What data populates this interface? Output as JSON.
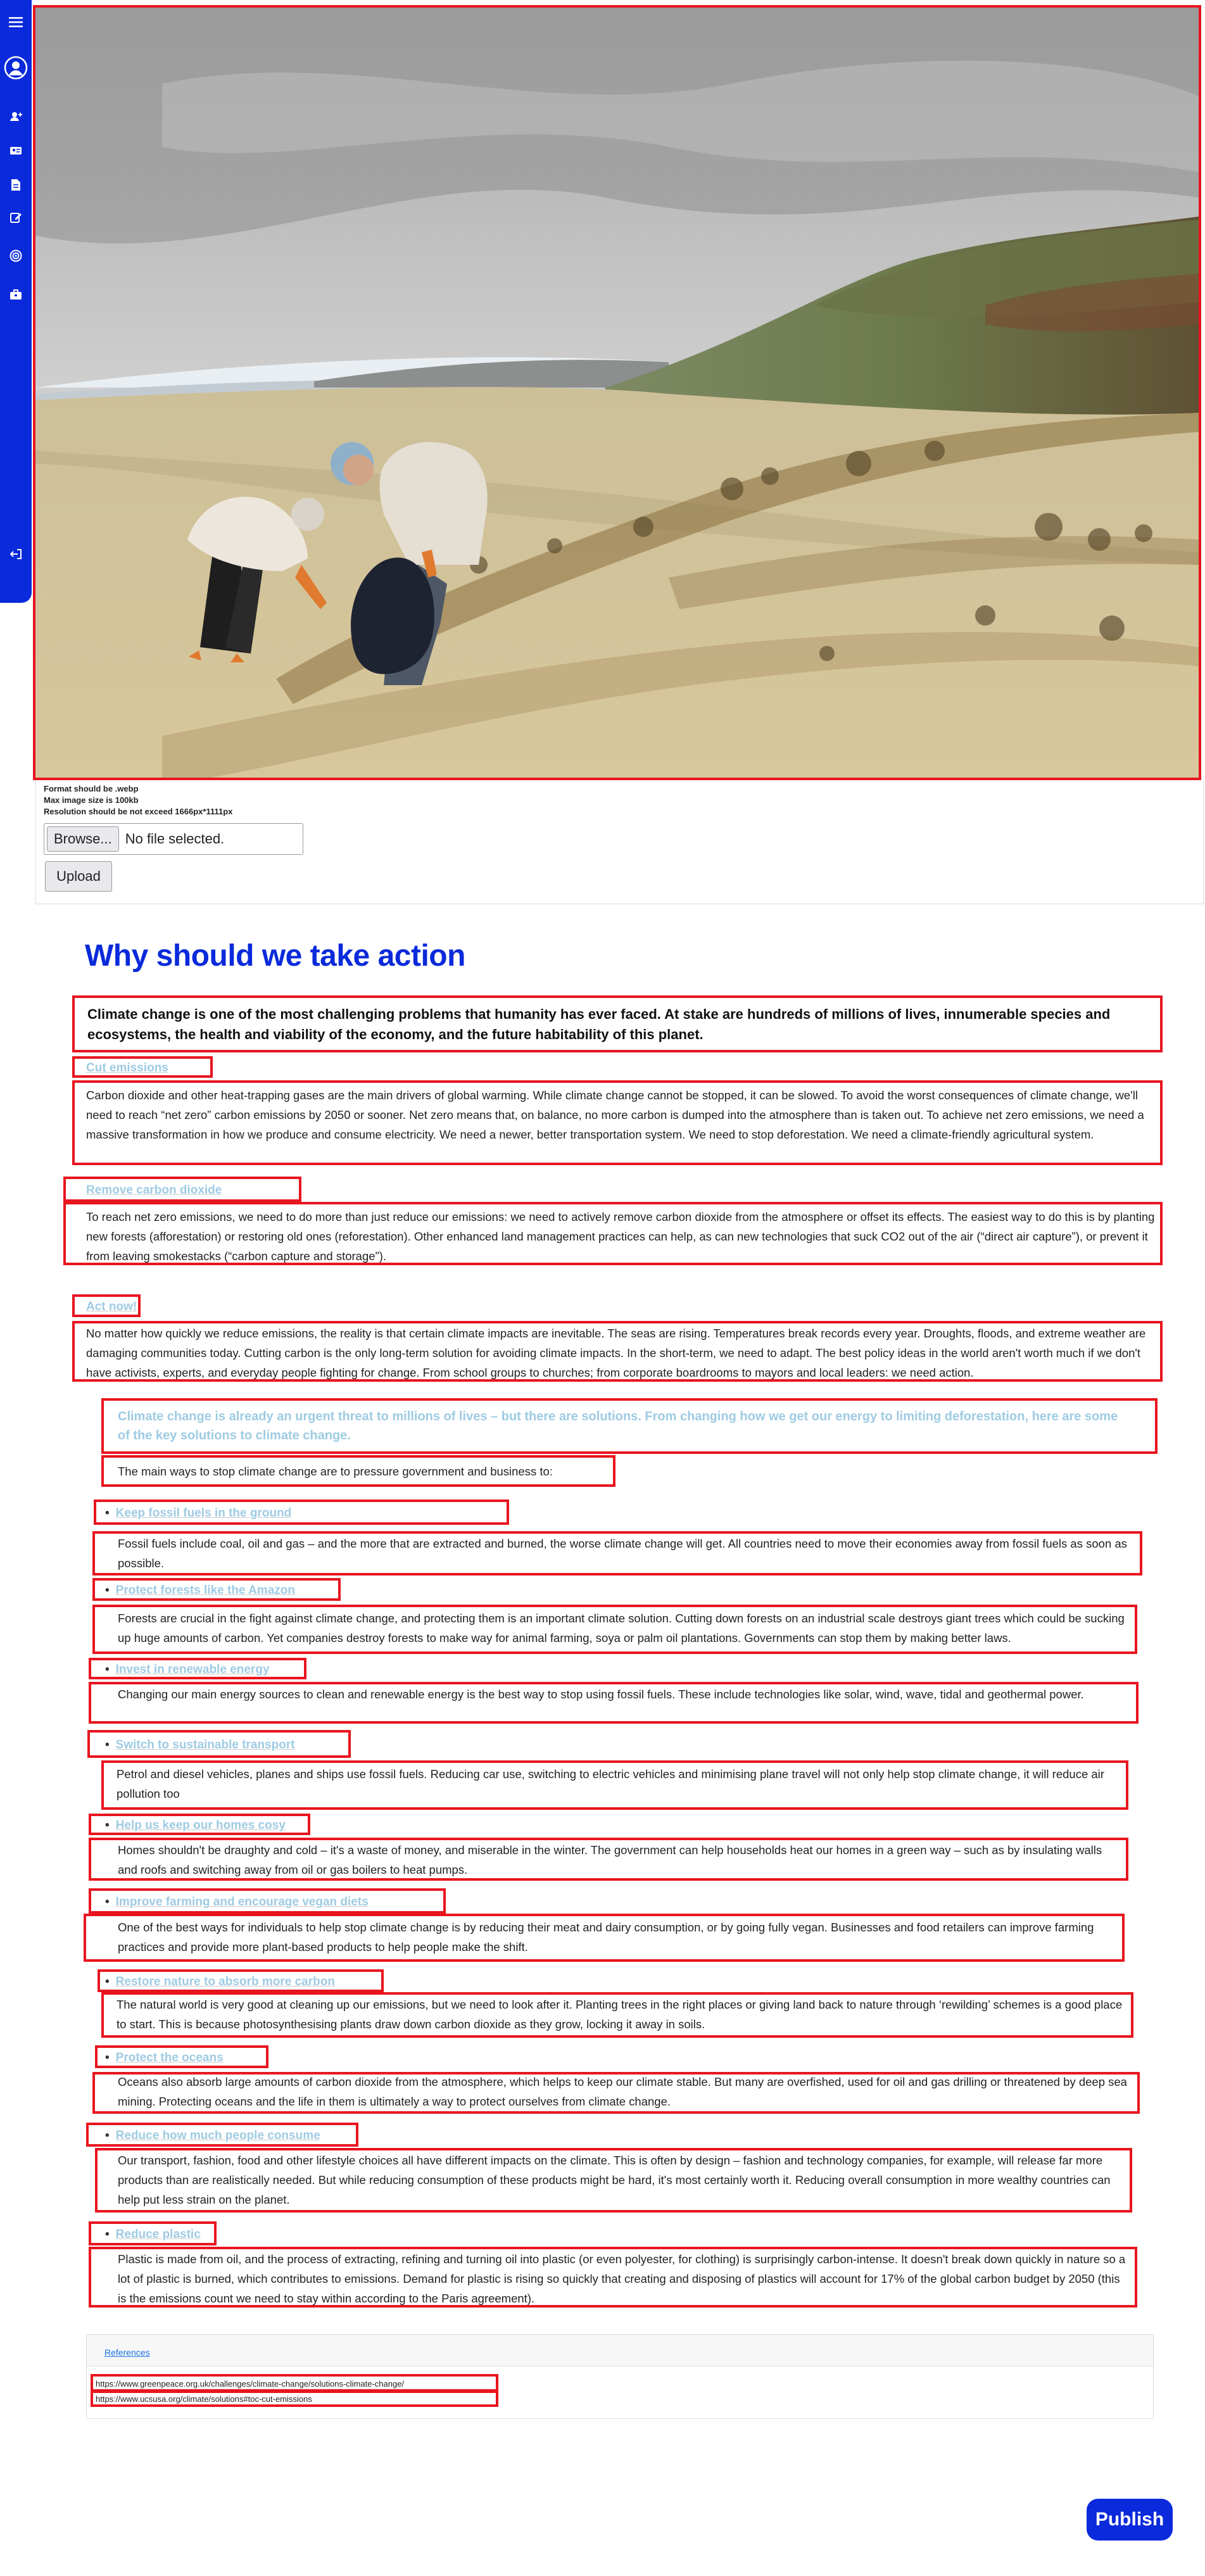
{
  "sidebar": {
    "items": [
      {
        "icon": "menu-icon"
      },
      {
        "icon": "user-avatar-icon"
      },
      {
        "icon": "add-user-icon"
      },
      {
        "icon": "id-card-icon"
      },
      {
        "icon": "document-icon"
      },
      {
        "icon": "edit-icon"
      },
      {
        "icon": "target-icon"
      },
      {
        "icon": "briefcase-icon"
      },
      {
        "icon": "logout-icon"
      }
    ]
  },
  "upload": {
    "note_format": "Format should be .webp",
    "note_size": "Max image size is 100kb",
    "note_resolution": "Resolution should be not exceed 1666px*1111px",
    "browse_label": "Browse...",
    "no_file_label": "No file selected.",
    "upload_label": "Upload"
  },
  "article": {
    "title": "Why should we take action",
    "lead": "Climate change is one of the most challenging problems that humanity has ever faced. At stake are hundreds of millions of lives, innumerable species and ecosystems, the health and viability of the economy, and the future habitability of this planet.",
    "sections": [
      {
        "heading": "Cut emissions",
        "body": "Carbon dioxide and other heat-trapping gases are the main drivers of global warming. While climate change cannot be stopped, it can be slowed. To avoid the worst consequences of climate change, we'll need to reach “net zero” carbon emissions by 2050 or sooner. Net zero means that, on balance, no more carbon is dumped into the atmosphere than is taken out. To achieve net zero emissions, we need a massive transformation in how we produce and consume electricity. We need a newer, better transportation system. We need to stop deforestation. We need a climate-friendly agricultural system."
      },
      {
        "heading": "Remove carbon dioxide",
        "body": "To reach net zero emissions, we need to do more than just reduce our emissions: we need to actively remove carbon dioxide from the atmosphere or offset its effects. The easiest way to do this is by planting new forests (afforestation) or restoring old ones (reforestation). Other enhanced land management practices can help, as can new technologies that suck CO2 out of the air (“direct air capture”), or prevent it from leaving smokestacks (“carbon capture and storage”)."
      },
      {
        "heading": "Act now!",
        "body": "No matter how quickly we reduce emissions, the reality is that certain climate impacts are inevitable. The seas are rising. Temperatures break records every year. Droughts, floods, and extreme weather are damaging communities today. Cutting carbon is the only long-term solution for avoiding climate impacts. In the short-term, we need to adapt. The best policy ideas in the world aren't worth much if we don't have activists, experts, and everyday people fighting for change. From school groups to churches; from corporate boardrooms to mayors and local leaders: we need action."
      }
    ],
    "callout": "Climate change is already an urgent threat to millions of lives – but there are solutions. From changing how we get our energy to limiting deforestation, here are some of the key solutions to climate change.",
    "intro": "The main ways to stop climate change are to pressure government and business to:",
    "solutions": [
      {
        "heading": "Keep fossil fuels in the ground",
        "body": "Fossil fuels include coal, oil and gas – and the more that are extracted and burned, the worse climate change will get. All countries need to move their economies away from fossil fuels as soon as possible."
      },
      {
        "heading": "Protect forests like the Amazon",
        "body": "Forests are crucial in the fight against climate change, and protecting them is an important climate solution. Cutting down forests on an industrial scale destroys giant trees which could be sucking up huge amounts of carbon. Yet companies destroy forests to make way for animal farming, soya or palm oil plantations. Governments can stop them by making better laws."
      },
      {
        "heading": "Invest in renewable energy",
        "body": "Changing our main energy sources to clean and renewable energy is the best way to stop using fossil fuels. These include technologies like solar, wind, wave, tidal and geothermal power."
      },
      {
        "heading": "Switch to sustainable transport",
        "body": "Petrol and diesel vehicles, planes and ships use fossil fuels. Reducing car use, switching to electric vehicles and minimising plane travel will not only help stop climate change, it will reduce air pollution too"
      },
      {
        "heading": "Help us keep our homes cosy",
        "body": "Homes shouldn't be draughty and cold – it's a waste of money, and miserable in the winter. The government can help households heat our homes in a green way – such as by insulating walls and roofs and switching away from oil or gas boilers to heat pumps."
      },
      {
        "heading": "Improve farming and encourage vegan diets",
        "body": "One of the best ways for individuals to help stop climate change is by reducing their meat and dairy consumption, or by going fully vegan. Businesses and food retailers can improve farming practices and provide more plant-based products to help people make the shift."
      },
      {
        "heading": "Restore nature to absorb more carbon",
        "body": "The natural world is very good at cleaning up our emissions, but we need to look after it. Planting trees in the right places or giving land back to nature through ‘rewilding’ schemes is a good place to start. This is because photosynthesising plants draw down carbon dioxide as they grow, locking it away in soils."
      },
      {
        "heading": "Protect the oceans",
        "body": "Oceans also absorb large amounts of carbon dioxide from the atmosphere, which helps to keep our climate stable. But many are overfished, used for oil and gas drilling or threatened by deep sea mining. Protecting oceans and the life in them is ultimately a way to protect ourselves from climate change."
      },
      {
        "heading": "Reduce how much people consume",
        "body": "Our transport, fashion, food and other lifestyle choices all have different impacts on the climate. This is often by design – fashion and technology companies, for example, will release far more products than are realistically needed. But while reducing consumption of these products might be hard, it's most certainly worth it. Reducing overall consumption in more wealthy countries can help put less strain on the planet."
      },
      {
        "heading": "Reduce plastic",
        "body": "Plastic is made from oil, and the process of extracting, refining and turning oil into plastic (or even polyester, for clothing) is surprisingly carbon-intense. It doesn't break down quickly in nature so a lot of plastic is burned, which contributes to emissions. Demand for plastic is rising so quickly that creating and disposing of plastics will account for 17% of the global carbon budget by 2050 (this is the emissions count we need to stay within according to the Paris agreement)."
      }
    ]
  },
  "references": {
    "label": "References",
    "links": [
      "https://www.greenpeace.org.uk/challenges/climate-change/solutions-climate-change/",
      "https://www.ucsusa.org/climate/solutions#toc-cut-emissions"
    ]
  },
  "publish_label": "Publish",
  "colors": {
    "brand": "#0a2adb",
    "highlight_border": "#e8151f",
    "subheading": "#9ecbe3"
  }
}
